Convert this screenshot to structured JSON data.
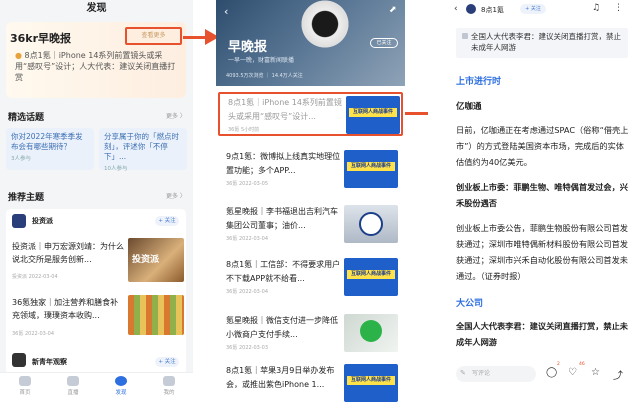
{
  "panel1": {
    "header": "发现",
    "brief": {
      "logo": "36kr早晚报",
      "more": "查看更多",
      "items": [
        "8点1氪｜iPhone 14系列前置镜头或采用“感叹号”设计；人大代表：建议关闭直播打赏"
      ]
    },
    "topics_title": "精选话题",
    "topics_more": "更多 〉",
    "topics": [
      {
        "title": "你对2022年寒季季发布会有哪些期待？",
        "sub": "3人参与"
      },
      {
        "title": "分享属于你的「燃点时刻」，评述你「不停下」...",
        "sub": "10人参与"
      }
    ],
    "rec_title": "推荐主题",
    "rec_more": "更多 〉",
    "rec_source": "投资派",
    "follow": "+ 关注",
    "rec_items": [
      {
        "title": "投资派｜申万宏源刘靖：为什么说北交所是服务创新...",
        "meta": "投资派 2022-03-04",
        "img": "投资派"
      },
      {
        "title": "36氪独家｜加注营养和膳食补充领域，璞璞资本收购...",
        "meta": "36氪 2022-03-04"
      }
    ],
    "rec_source2": "新青年观察",
    "tabs": [
      "首页",
      "直播",
      "发现",
      "我的"
    ]
  },
  "panel2": {
    "title": "早晚报",
    "sub": "一早一晚，财富新闻联播",
    "stats": "4093.5万次浏览 ｜ 14.4万人关注",
    "follow": "已关注",
    "thumb_label": "互联网人商战事件",
    "articles": [
      {
        "title": "8点1氪｜iPhone 14系列前置镜头或采用“感叹号”设计...",
        "meta": "36氪 5小时前",
        "thumb": "blue"
      },
      {
        "title": "9点1氪：微博拟上线真实地理位置功能；多个APP...",
        "meta": "36氪 2022-03-05",
        "thumb": "blue"
      },
      {
        "title": "氪星晚报｜李书福退出吉利汽车集团公司董事；油价...",
        "meta": "36氪 2022-03-04",
        "thumb": "geely"
      },
      {
        "title": "8点1氪｜工信部：不得要求用户不下载APP就不给看...",
        "meta": "36氪 2022-03-04",
        "thumb": "blue"
      },
      {
        "title": "氪星晚报｜微信支付进一步降低小微商户支付手续...",
        "meta": "36氪 2022-03-03",
        "thumb": "wechat"
      },
      {
        "title": "8点1氪｜苹果3月9日举办发布会，或推出紫色iPhone 1...",
        "meta": "",
        "thumb": "blue"
      }
    ]
  },
  "panel3": {
    "author": "8点1氪",
    "follow": "+ 关注",
    "notice": "全国人大代表李君：建议关闭直播打赏，禁止未成年人网游",
    "section1": "上市进行时",
    "sub1": "亿咖通",
    "para1": "日前，亿咖通正在考虑通过SPAC（俗称“借壳上市”）的方式登陆美国资本市场，完成后的实体估值约为40亿美元。",
    "sub2": "创业板上市委：菲鹏生物、唯特偶首发过会，兴禾股份遇否",
    "para2": "创业板上市委公告，菲鹏生物股份有限公司首发获通过；深圳市唯特偶新材料股份有限公司首发获通过；深圳市兴禾自动化股份有限公司首发未通过。（证券时报）",
    "section2": "大公司",
    "sub3": "全国人大代表李君：建议关闭直播打赏，禁止未成年人网游",
    "comment_placeholder": "写评论",
    "badges": [
      "2",
      "46"
    ]
  },
  "colors": {
    "accent": "#e8512d",
    "link": "#2d6fe0"
  }
}
